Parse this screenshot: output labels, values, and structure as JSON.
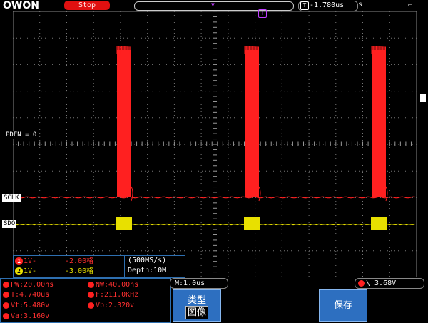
{
  "top": {
    "logo": "OWON",
    "status": "Stop",
    "trigger_position_icon": "T",
    "trigger_position": "-1.780us",
    "trigger_position_suffix": "s"
  },
  "channel_labels": {
    "pden": "PDEN = 0",
    "sclk": "SCLK",
    "sdo": "SDO"
  },
  "channels": [
    {
      "id": "1",
      "coupling": "1V-",
      "offset": "-2.00格",
      "color": "#ff2020"
    },
    {
      "id": "2",
      "coupling": "1V-",
      "offset": "-3.00格",
      "color": "#e8e000"
    }
  ],
  "acquisition": {
    "sample_rate": "(500MS/s)",
    "depth": "Depth:10M"
  },
  "measurements": {
    "pw": "PW:20.00ns",
    "nw": "NW:40.00ns",
    "t": "T:4.740us",
    "f": "F:211.0KHz",
    "vt": "Vt:5.480v",
    "vb": "Vb:2.320v",
    "va": "Va:3.160v"
  },
  "timebase": "M:1.0us",
  "trigger_level": "\\_3.68V",
  "softkeys": {
    "type_label": "类型",
    "type_value": "图像",
    "save_label": "保存"
  },
  "colors": {
    "ch1": "#ff2020",
    "ch2": "#e8e000",
    "panel_border": "#2e6fb0",
    "softkey": "#2d6fc0"
  }
}
